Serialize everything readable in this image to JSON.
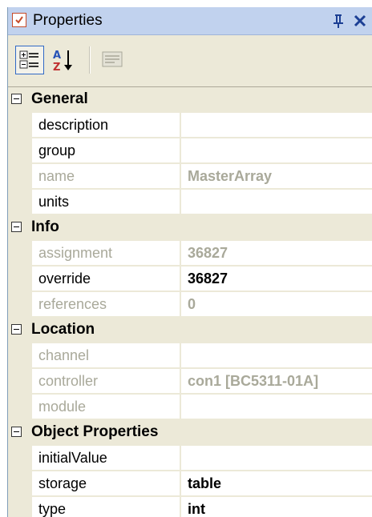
{
  "window": {
    "title": "Properties",
    "pin_glyph": "p",
    "close_glyph": "✕"
  },
  "toolbar": {
    "buttons": [
      {
        "name": "categorized-button",
        "icon": "categorized-icon",
        "active": true
      },
      {
        "name": "alphabetical-button",
        "icon": "sort-az-icon",
        "active": false
      },
      {
        "name": "property-pages-button",
        "icon": "property-pages-icon",
        "enabled": false
      }
    ]
  },
  "grid": {
    "categories": [
      {
        "label": "General",
        "properties": [
          {
            "name": "description",
            "value": "",
            "enabled": true
          },
          {
            "name": "group",
            "value": "",
            "enabled": true
          },
          {
            "name": "name",
            "value": "MasterArray",
            "enabled": false
          },
          {
            "name": "units",
            "value": "",
            "enabled": true
          }
        ]
      },
      {
        "label": "Info",
        "properties": [
          {
            "name": "assignment",
            "value": "36827",
            "enabled": false
          },
          {
            "name": "override",
            "value": "36827",
            "enabled": true
          },
          {
            "name": "references",
            "value": "0",
            "enabled": false
          }
        ]
      },
      {
        "label": "Location",
        "properties": [
          {
            "name": "channel",
            "value": "",
            "enabled": false
          },
          {
            "name": "controller",
            "value": "con1 [BC5311-01A]",
            "enabled": false
          },
          {
            "name": "module",
            "value": "",
            "enabled": false
          }
        ]
      },
      {
        "label": "Object Properties",
        "properties": [
          {
            "name": "initialValue",
            "value": "",
            "enabled": true
          },
          {
            "name": "storage",
            "value": "table",
            "enabled": true
          },
          {
            "name": "type",
            "value": "int",
            "enabled": true
          }
        ]
      }
    ]
  },
  "colors": {
    "title_bar": "#c1d2ee",
    "panel_bg": "#ece9d8",
    "disabled_text": "#a9a99a",
    "accent": "#1c3f94"
  }
}
